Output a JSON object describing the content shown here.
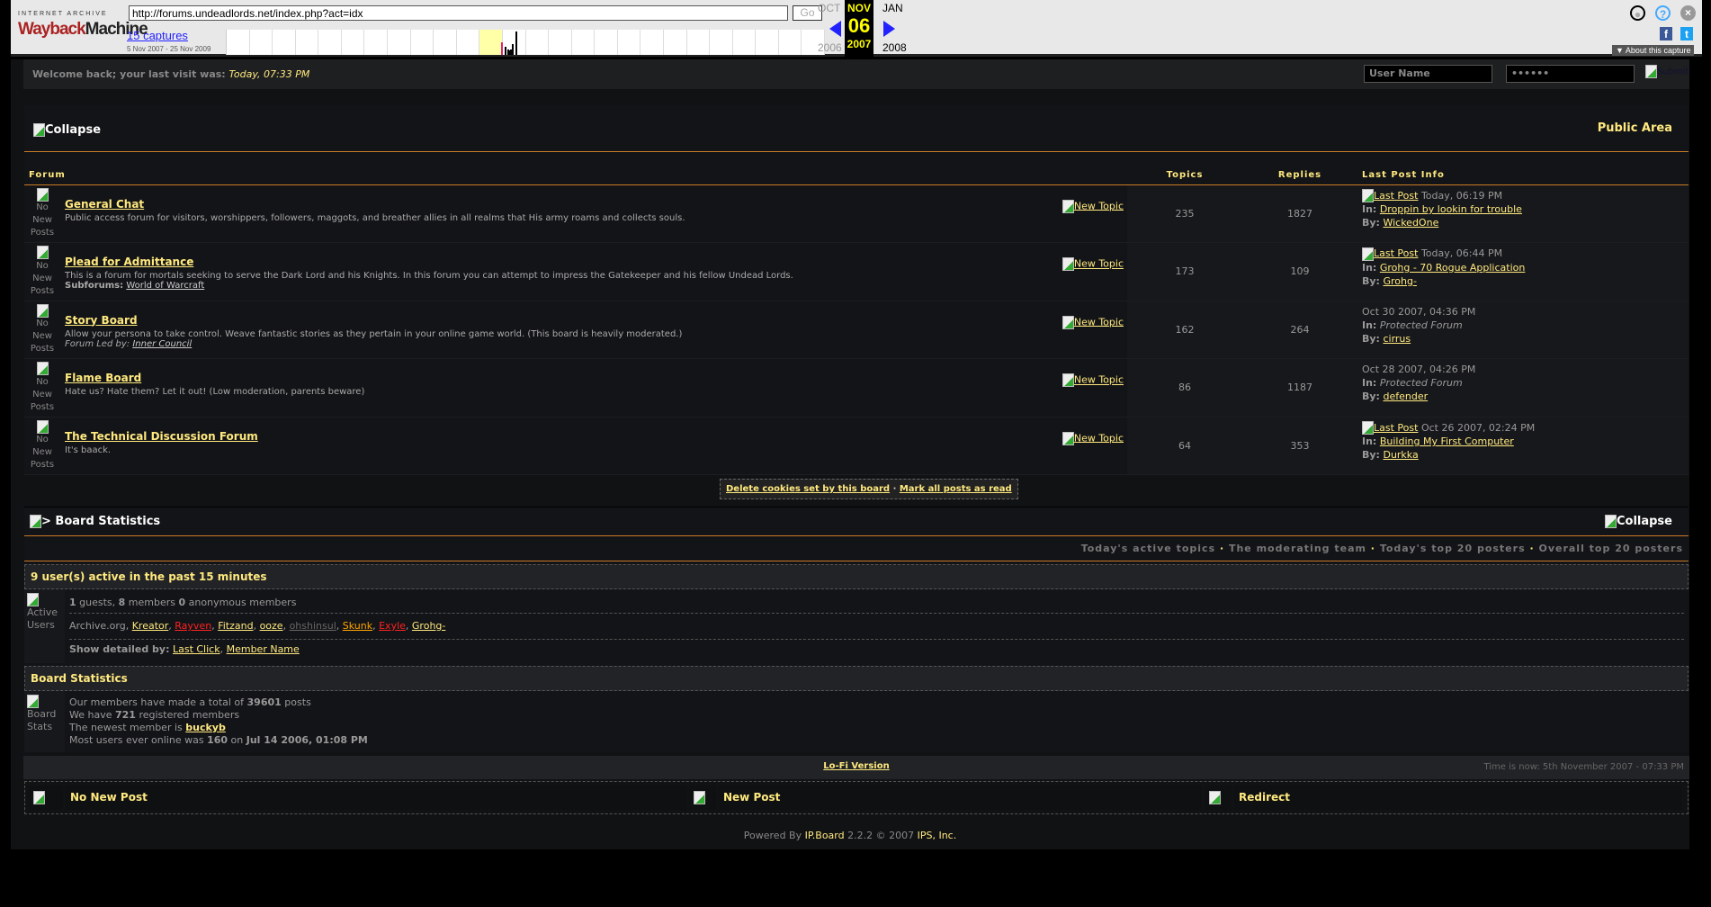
{
  "wayback": {
    "logo_top": "INTERNET ARCHIVE",
    "logo_a": "Wayback",
    "logo_b": "Machine",
    "url": "http://forums.undeadlords.net/index.php?act=idx",
    "go": "Go",
    "captures": "15 captures",
    "range": "5 Nov 2007 - 25 Nov 2009",
    "prev_month": "OCT",
    "cur_month": "NOV",
    "next_month": "JAN",
    "day": "06",
    "prev_year": "2006",
    "cur_year": "2007",
    "next_year": "2008",
    "about": "▼ About this capture"
  },
  "welcome": {
    "text": "Welcome back; your last visit was:",
    "time": "Today, 07:33 PM",
    "user_placeholder": "User Name",
    "password": "••••••",
    "submit": "Submit"
  },
  "forums": {
    "collapse": "Collapse",
    "area": "Public Area",
    "headers": [
      "Forum",
      "Topics",
      "Replies",
      "Last Post Info"
    ],
    "icon_alt": "No New Posts",
    "new_topic": "New Topic",
    "rows": [
      {
        "name": "General Chat",
        "desc": "Public access forum for visitors, worshippers, followers, maggots, and breather allies in all realms that His army roams and collects souls.",
        "extra_label": "",
        "extra": "",
        "topics": "235",
        "replies": "1827",
        "lp_link": "Last Post",
        "lp_time": "Today, 06:19 PM",
        "in": "Droppin by lookin for trouble",
        "by": "WickedOne"
      },
      {
        "name": "Plead for Admittance",
        "desc": "This is a forum for mortals seeking to serve the Dark Lord and his Knights. In this forum you can attempt to impress the Gatekeeper and his fellow Undead Lords.",
        "extra_label": "Subforums:",
        "extra": "World of Warcraft",
        "topics": "173",
        "replies": "109",
        "lp_link": "Last Post",
        "lp_time": "Today, 06:44 PM",
        "in": "Grohg - 70 Rogue Application",
        "by": "Grohg-"
      },
      {
        "name": "Story Board",
        "desc": "Allow your persona to take control. Weave fantastic stories as they pertain in your online game world. (This board is heavily moderated.)",
        "extra_label": "Forum Led by:",
        "extra": "Inner Council",
        "topics": "162",
        "replies": "264",
        "lp_link": "",
        "lp_time": "Oct 30 2007, 04:36 PM",
        "in": "Protected Forum",
        "by": "cirrus"
      },
      {
        "name": "Flame Board",
        "desc": "Hate us? Hate them? Let it out! (Low moderation, parents beware)",
        "extra_label": "",
        "extra": "",
        "topics": "86",
        "replies": "1187",
        "lp_link": "",
        "lp_time": "Oct 28 2007, 04:26 PM",
        "in": "Protected Forum",
        "by": "defender"
      },
      {
        "name": "The Technical Discussion Forum",
        "desc": "It's baack.",
        "extra_label": "",
        "extra": "",
        "topics": "64",
        "replies": "353",
        "lp_link": "Last Post",
        "lp_time": "Oct 26 2007, 02:24 PM",
        "in": "Building My First Computer",
        "by": "Durkka"
      }
    ],
    "in_label": "In:",
    "by_label": "By:"
  },
  "cookies": {
    "delete": "Delete cookies set by this board",
    "sep": " · ",
    "mark": "Mark all posts as read"
  },
  "stats": {
    "title": "> Board Statistics",
    "collapse": "Collapse",
    "links": [
      "Today's active topics",
      "The moderating team",
      "Today's top 20 posters",
      "Overall top 20 posters"
    ],
    "active_title": "9 user(s) active in the past 15 minutes",
    "active_icon": "Active Users",
    "guests": "1",
    "guests_l": " guests, ",
    "members": "8",
    "members_l": " members ",
    "anon": "0",
    "anon_l": " anonymous members",
    "users": [
      {
        "n": "Archive.org",
        "c": "#999",
        "link": false
      },
      {
        "n": "Kreator",
        "c": "#ffe97f",
        "link": true
      },
      {
        "n": "Rayven",
        "c": "#ff2222",
        "link": true
      },
      {
        "n": "Fitzand",
        "c": "#ffe97f",
        "link": true
      },
      {
        "n": "ooze",
        "c": "#ffe97f",
        "link": true
      },
      {
        "n": "ohshinsul",
        "c": "#666",
        "link": true
      },
      {
        "n": "Skunk",
        "c": "#ffa500",
        "link": true
      },
      {
        "n": "Exyle",
        "c": "#ff2222",
        "link": true
      },
      {
        "n": "Grohg-",
        "c": "#ffe97f",
        "link": true
      }
    ],
    "show_label": "Show detailed by:",
    "show1": "Last Click",
    "show2": "Member Name",
    "bs_title": "Board Statistics",
    "bs_icon": "Board Stats",
    "l1a": "Our members have made a total of ",
    "posts": "39601",
    "l1b": " posts",
    "l2a": "We have ",
    "regs": "721",
    "l2b": " registered members",
    "l3a": "The newest member is ",
    "newest": "buckyb",
    "l4a": "Most users ever online was ",
    "most": "160",
    "l4b": " on ",
    "most_date": "Jul 14 2006, 01:08 PM"
  },
  "footer": {
    "lofi": "Lo-Fi Version",
    "time": "Time is now: 5th November 2007 - 07:33 PM",
    "legend": [
      "No New Post",
      "New Post",
      "Redirect"
    ],
    "powered": "Powered By ",
    "ipb": "IP.Board",
    "ver": " 2.2.2 © 2007  ",
    "ips": "IPS, Inc."
  }
}
